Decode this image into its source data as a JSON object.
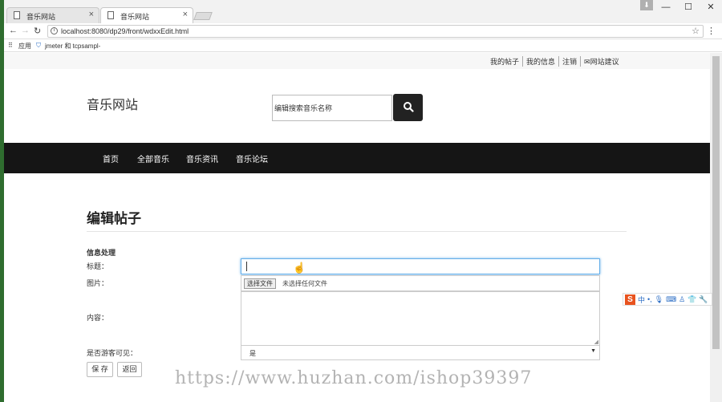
{
  "browser": {
    "tabs": [
      {
        "title": "音乐网站",
        "active": false
      },
      {
        "title": "音乐网站",
        "active": true
      }
    ],
    "url": "localhost:8080/dp29/front/wdxxEdit.html",
    "bookmarks": [
      "应用",
      "jmeter 和 tcpsampl-"
    ],
    "window_controls": {
      "minimize": "—",
      "maximize": "☐",
      "close": "✕"
    }
  },
  "site": {
    "top_links": [
      "我的帖子",
      "我的信息",
      "注销",
      "✉网站建议"
    ],
    "name": "音乐网站",
    "search": {
      "value": "编辑搜索音乐名称"
    },
    "nav": [
      "首页",
      "全部音乐",
      "音乐资讯",
      "音乐论坛"
    ]
  },
  "form": {
    "heading": "编辑帖子",
    "section_label": "信息处理",
    "title_label": "标题：",
    "title_value": "",
    "image_label": "图片：",
    "file_button": "选择文件",
    "file_status": "未选择任何文件",
    "content_label": "内容：",
    "visible_label": "是否游客可见：",
    "visible_value": "是",
    "save_button": "保 存",
    "back_button": "返回"
  },
  "watermark": "https://www.huzhan.com/ishop39397",
  "ime_toolbar": {
    "logo": "S",
    "mode": "中"
  },
  "colors": {
    "navbar": "#151515",
    "search_button": "#222222",
    "focus": "#66afe9"
  }
}
